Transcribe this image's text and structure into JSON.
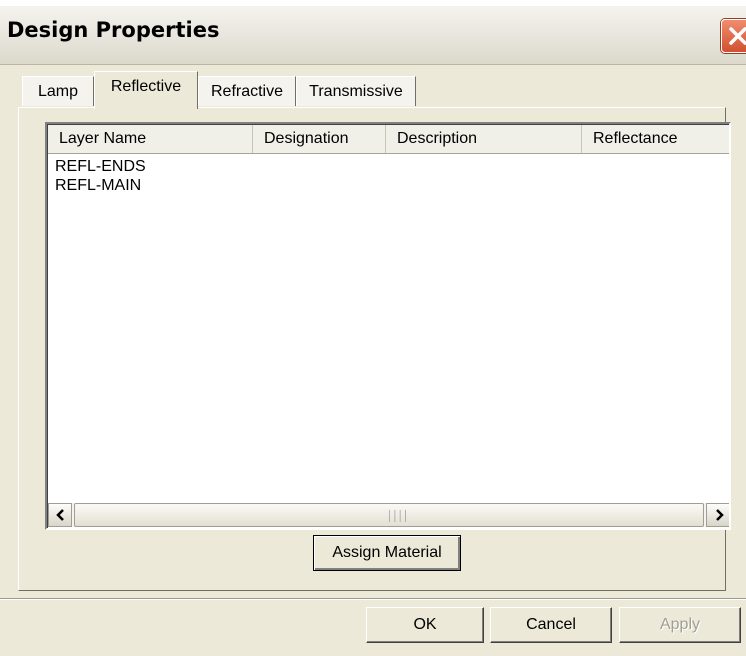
{
  "window": {
    "title": "Design Properties"
  },
  "tabs": [
    {
      "label": "Lamp",
      "active": false
    },
    {
      "label": "Reflective",
      "active": true
    },
    {
      "label": "Refractive",
      "active": false
    },
    {
      "label": "Transmissive",
      "active": false
    }
  ],
  "list": {
    "columns": [
      "Layer Name",
      "Designation",
      "Description",
      "Reflectance"
    ],
    "rows": [
      {
        "layer_name": "REFL-ENDS",
        "designation": "",
        "description": "",
        "reflectance": ""
      },
      {
        "layer_name": "REFL-MAIN",
        "designation": "",
        "description": "",
        "reflectance": ""
      }
    ]
  },
  "panel": {
    "assign_label": "Assign Material"
  },
  "footer": {
    "ok_label": "OK",
    "cancel_label": "Cancel",
    "apply_label": "Apply"
  },
  "icons": {
    "close": "close-icon",
    "scroll_left": "arrow-left-icon",
    "scroll_right": "arrow-right-icon",
    "scroll_grip": "scroll-grip-icon"
  },
  "colors": {
    "close_button": "#d1512f",
    "dialog_face": "#ece9d8"
  }
}
